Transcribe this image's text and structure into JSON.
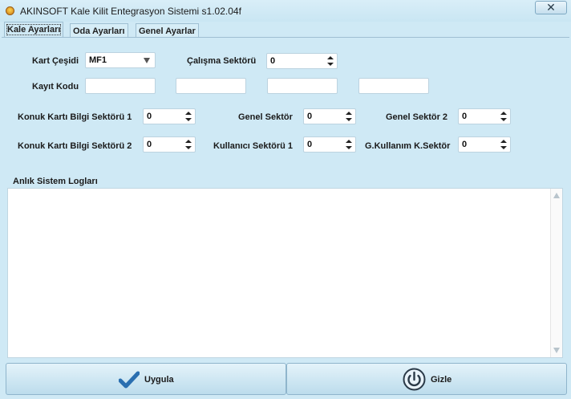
{
  "window": {
    "title": "AKINSOFT Kale Kilit Entegrasyon Sistemi s1.02.04f",
    "close_glyph": "✕"
  },
  "tabs": [
    "Kale Ayarları",
    "Oda Ayarları",
    "Genel Ayarlar"
  ],
  "form": {
    "kart_cesidi_label": "Kart Çeşidi",
    "kart_cesidi_value": "MF1",
    "calisma_sektoru_label": "Çalışma Sektörü",
    "calisma_sektoru_value": "0",
    "kayit_kodu_label": "Kayıt Kodu",
    "kayit_kodu_values": [
      "",
      "",
      "",
      ""
    ],
    "konuk1_label": "Konuk Kartı Bilgi Sektörü 1",
    "konuk1_value": "0",
    "genel_sektor_label": "Genel Sektör",
    "genel_sektor_value": "0",
    "genel_sektor2_label": "Genel Sektör 2",
    "genel_sektor2_value": "0",
    "konuk2_label": "Konuk Kartı Bilgi Sektörü 2",
    "konuk2_value": "0",
    "kullanici_label": "Kullanıcı Sektörü 1",
    "kullanici_value": "0",
    "gkullanim_label": "G.Kullanım K.Sektör",
    "gkullanim_value": "0"
  },
  "logs": {
    "label": "Anlık Sistem Logları",
    "content": ""
  },
  "buttons": {
    "apply": "Uygula",
    "hide": "Gizle"
  },
  "colors": {
    "window_bg": "#cfe9f5",
    "check_icon": "#2a6fb0"
  },
  "icons": {
    "apply": "checkmark-icon",
    "hide": "power-icon",
    "app": "app-logo-icon",
    "close": "close-icon"
  }
}
